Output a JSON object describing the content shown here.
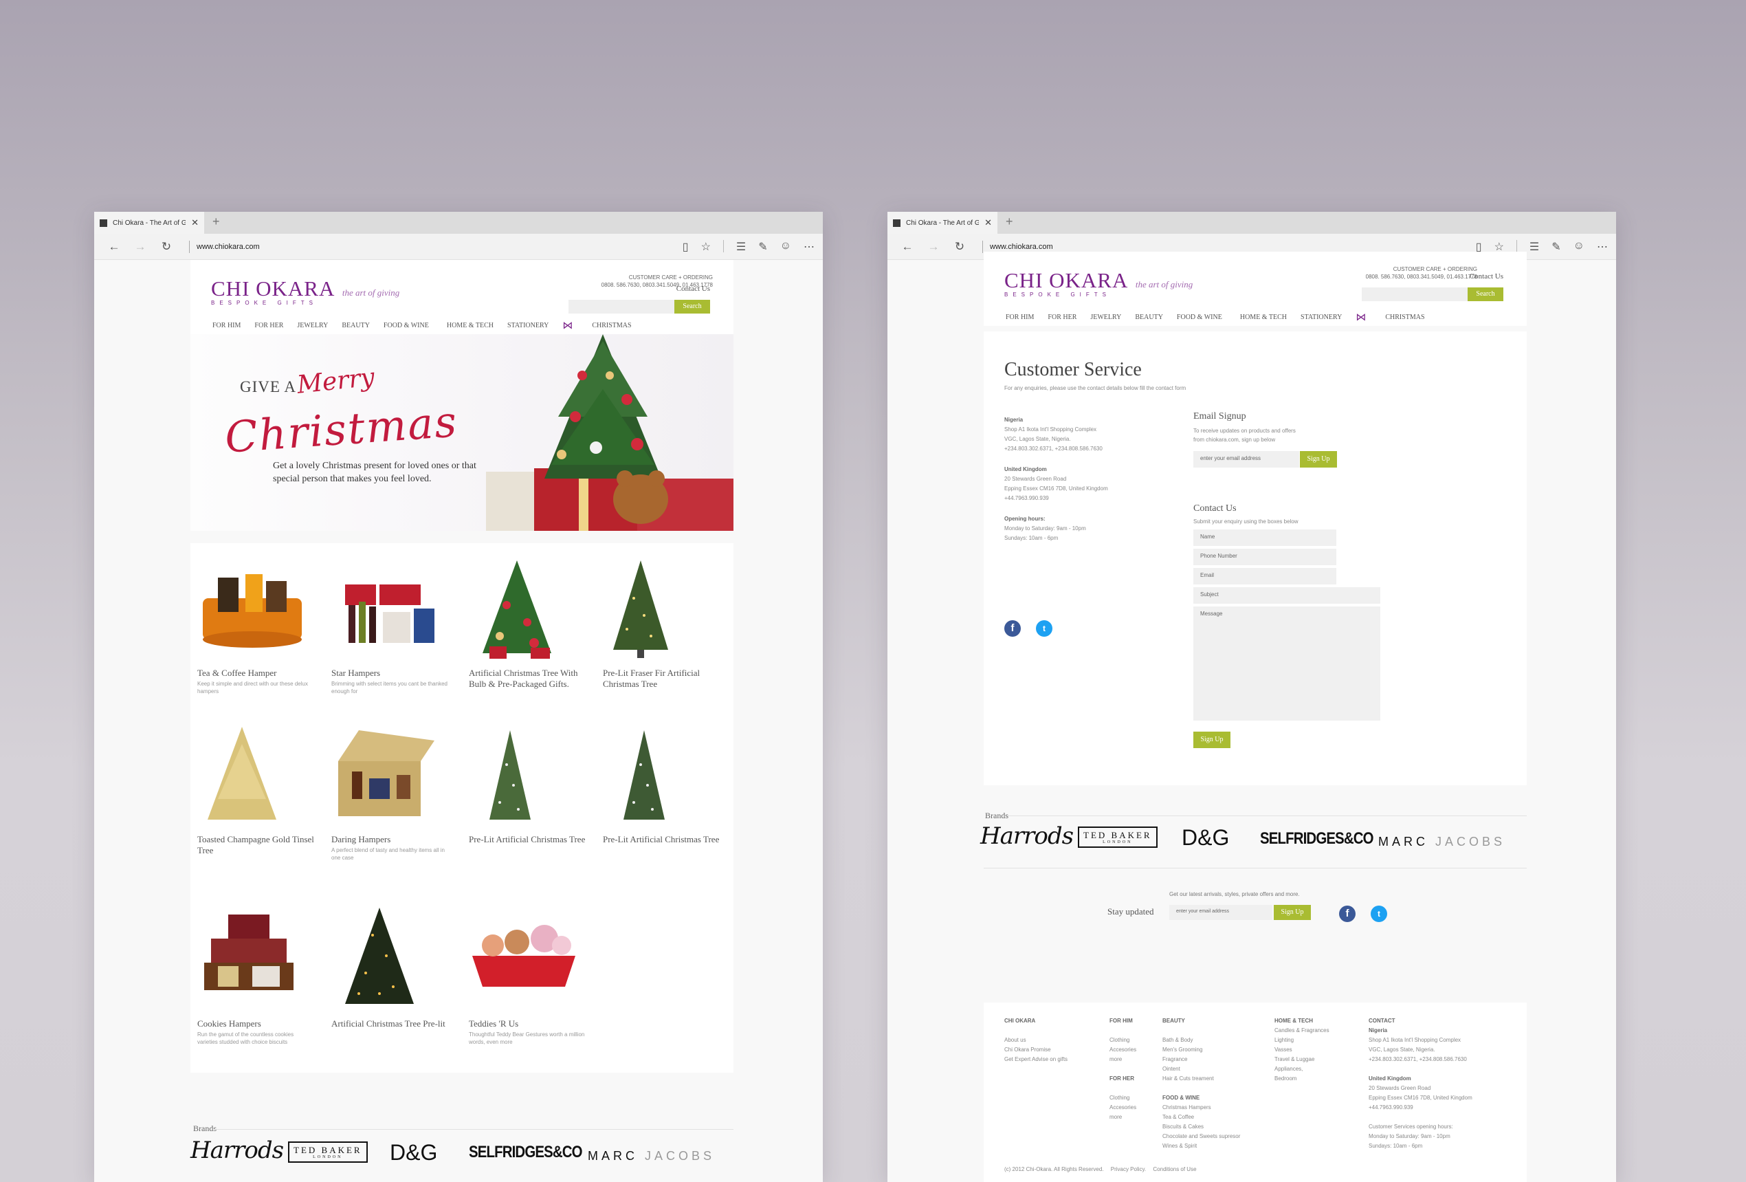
{
  "colors": {
    "brand_purple": "#7a2389",
    "accent_green": "#a9bc32",
    "hero_red": "#c21b3e"
  },
  "browser": {
    "tab_title": "Chi Okara - The Art of Giv",
    "url": "www.chiokara.com"
  },
  "site": {
    "brand_name": "CHI OKARA",
    "brand_tagline": "the art of giving",
    "brand_sub": "BESPOKE GIFTS",
    "care_label": "CUSTOMER CARE + ORDERING",
    "care_phones": "0808. 586.7630, 0803.341.5049, 01.463.1778",
    "contact_link": "Contact Us",
    "search_label": "Search",
    "menu": [
      "FOR HIM",
      "FOR HER",
      "JEWELRY",
      "BEAUTY",
      "FOOD & WINE",
      "HOME & TECH",
      "STATIONERY",
      "CHRISTMAS"
    ]
  },
  "home": {
    "hero": {
      "give_a": "GIVE A",
      "merry": "Merry",
      "christmas": "Christmas",
      "copy": "Get a lovely Christmas present for loved ones or that special person that makes you feel loved."
    },
    "products": [
      {
        "name": "Tea & Coffee Hamper",
        "desc": "Keep it simple and direct with our these delux hampers"
      },
      {
        "name": "Star Hampers",
        "desc": "Brimming with select items you cant be thanked enough for"
      },
      {
        "name": "Artificial Christmas Tree With Bulb & Pre-Packaged Gifts.",
        "desc": ""
      },
      {
        "name": "Pre-Lit Fraser Fir Artificial Christmas Tree",
        "desc": ""
      },
      {
        "name": "Toasted Champagne Gold Tinsel Tree",
        "desc": ""
      },
      {
        "name": "Daring Hampers",
        "desc": "A perfect blend of tasty and healthy items all in one case"
      },
      {
        "name": "Pre-Lit Artificial Christmas Tree",
        "desc": ""
      },
      {
        "name": "Pre-Lit Artificial Christmas Tree",
        "desc": ""
      },
      {
        "name": "Cookies Hampers",
        "desc": "Run the gamut of the countless cookies varieties studded with choice biscuits"
      },
      {
        "name": "Artificial Christmas Tree Pre-lit",
        "desc": ""
      },
      {
        "name": "Teddies 'R Us",
        "desc": "Thoughtful Teddy Bear Gestures worth a million words, even more"
      }
    ]
  },
  "brands": {
    "title": "Brands",
    "items": [
      "Harrods",
      "TED BAKER",
      "LONDON",
      "D&G",
      "SELFRIDGES&CO",
      "MARC",
      "JACOBS"
    ]
  },
  "customer_service": {
    "title": "Customer Service",
    "subtitle": "For any enquiries, please use the contact details below fill the contact form",
    "nigeria": {
      "label": "Nigeria",
      "line1": "Shop A1 Ikota Int'l Shopping Complex",
      "line2": "VGC, Lagos State, Nigeria.",
      "line3": "+234.803.302.6371, +234.808.586.7630"
    },
    "uk": {
      "label": "United Kingdom",
      "line1": "20 Stewards Green Road",
      "line2": "Epping Essex CM16 7D8, United Kingdom",
      "line3": "+44.7963.990.939"
    },
    "hours": {
      "label": "Opening hours:",
      "line1": "Monday to Saturday: 9am - 10pm",
      "line2": "Sundays: 10am - 6pm"
    },
    "email_signup": {
      "title": "Email Signup",
      "note1": "To receive updates on products and offers",
      "note2": "from chiokara.com, sign up below",
      "placeholder": "enter your email address",
      "button": "Sign Up"
    },
    "contact_form": {
      "title": "Contact Us",
      "note": "Submit your enquiry using the boxes below",
      "name": "Name",
      "phone": "Phone Number",
      "email": "Email",
      "subject": "Subject",
      "message": "Message",
      "button": "Sign Up"
    }
  },
  "stay_updated": {
    "note": "Get our latest arrivals, styles, private offers and more.",
    "label": "Stay updated",
    "placeholder": "enter your email address",
    "button": "Sign Up"
  },
  "footer": {
    "chi_okara": {
      "title": "CHI OKARA",
      "items": [
        "About us",
        "Chi Okara Promise",
        "Get Expert Advise on gifts"
      ]
    },
    "for_him": {
      "title": "FOR HIM",
      "items": [
        "Clothing",
        "Accesories",
        "more"
      ]
    },
    "for_her": {
      "title": "FOR HER",
      "items": [
        "Clothing",
        "Accesories",
        "more"
      ]
    },
    "beauty": {
      "title": "BEAUTY",
      "items": [
        "Bath & Body",
        "Men's Grooming",
        "Fragrance",
        "Ointent",
        "Hair & Cuts treament"
      ]
    },
    "food_wine": {
      "title": "FOOD & WINE",
      "items": [
        "Christmas Hampers",
        "Tea & Coffee",
        "Biscuits & Cakes",
        "Chocolate and Sweets supresor",
        "Wines & Spirit"
      ]
    },
    "home_tech": {
      "title": "HOME & TECH",
      "items": [
        "Candles & Fragrances",
        "Lighting",
        "Vasses",
        "Travel & Luggae",
        "Appliances,",
        "Bedroom"
      ]
    },
    "contact": {
      "title": "CONTACT",
      "items": [
        "Nigeria",
        "Shop A1 Ikota Int'l Shopping Complex",
        "VGC, Lagos State, Nigeria.",
        "+234.803.302.6371, +234.808.586.7630",
        "",
        "United Kingdom",
        "20 Stewards Green Road",
        "Epping Essex CM16 7D8, United Kingdom",
        "+44.7963.990.939",
        "",
        "Customer Services opening hours:",
        "Monday to Saturday: 9am - 10pm",
        "Sundays: 10am - 6pm"
      ]
    },
    "copyright": "(c) 2012 Chi-Okara. All Rights Reserved.",
    "privacy": "Privacy Policy.",
    "conditions": "Conditions of Use"
  },
  "icons": [
    "back-icon",
    "forward-icon",
    "refresh-icon",
    "reading-view-icon",
    "favorite-star-icon",
    "hub-icon",
    "web-note-icon",
    "feedback-icon",
    "more-icon",
    "bow-icon",
    "facebook-icon",
    "twitter-icon"
  ]
}
